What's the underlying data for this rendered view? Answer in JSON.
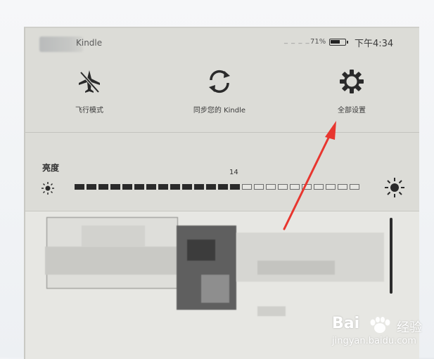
{
  "status_bar": {
    "device_name": "Kindle",
    "wifi": "_ _ _ _",
    "battery_text": "71%",
    "battery_level": 0.71,
    "time": "下午4:34"
  },
  "quick_actions": [
    {
      "label": "飞行模式",
      "icon": "airplane-icon"
    },
    {
      "label": "同步您的 Kindle",
      "icon": "sync-icon"
    },
    {
      "label": "全部设置",
      "icon": "gear-icon"
    }
  ],
  "brightness": {
    "title": "亮度",
    "value": "14",
    "level": 14,
    "max": 24
  },
  "watermark": {
    "brand_left": "Bai",
    "brand_right": "经验",
    "url": "jingyan.baidu.com"
  },
  "colors": {
    "screen": "#dcdcd7",
    "ink": "#2a2a2a",
    "annotation_arrow": "#e8362f"
  }
}
